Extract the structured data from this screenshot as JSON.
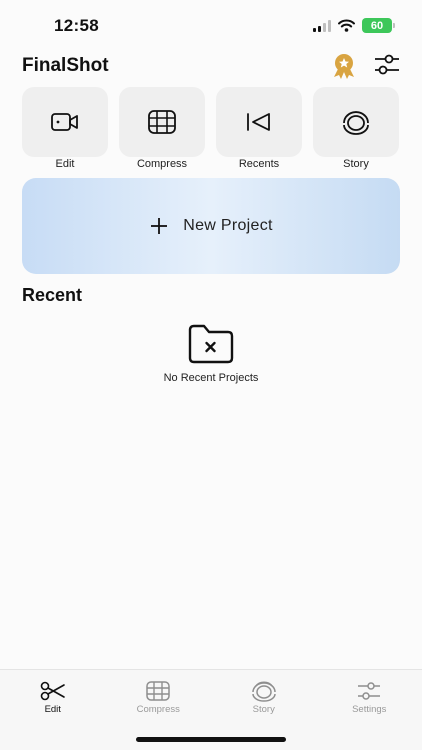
{
  "status": {
    "time": "12:58",
    "battery": "60"
  },
  "app": {
    "title": "FinalShot"
  },
  "header_icons": [
    "award-icon",
    "sliders-icon"
  ],
  "tiles": [
    {
      "label": "Edit",
      "icon": "video-camera-icon"
    },
    {
      "label": "Compress",
      "icon": "film-icon"
    },
    {
      "label": "Recents",
      "icon": "skip-back-icon"
    },
    {
      "label": "Story",
      "icon": "story-icon"
    }
  ],
  "new_project": {
    "label": "New Project",
    "icon": "plus-icon"
  },
  "recent": {
    "title": "Recent",
    "empty_label": "No Recent Projects",
    "icon": "folder-x-icon"
  },
  "tabbar": {
    "active": "Edit",
    "items": [
      {
        "label": "Edit",
        "icon": "scissors-icon"
      },
      {
        "label": "Compress",
        "icon": "film-icon"
      },
      {
        "label": "Story",
        "icon": "story-icon"
      },
      {
        "label": "Settings",
        "icon": "sliders-icon"
      }
    ]
  },
  "colors": {
    "accent_gold": "#d9a441",
    "banner_blue": "#c7dcf5",
    "tile_bg": "#efefef",
    "battery_green": "#3dc75a"
  }
}
